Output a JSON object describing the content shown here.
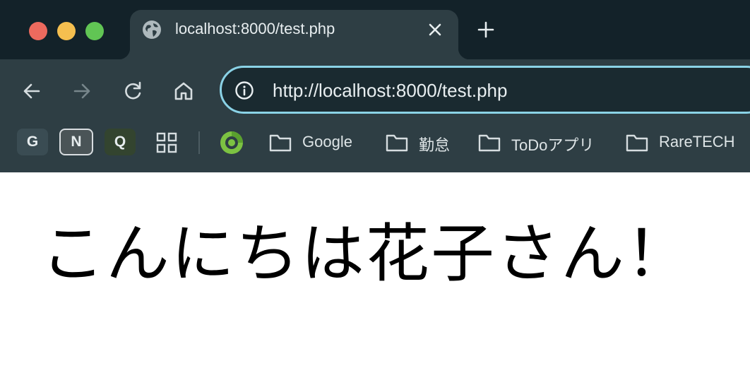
{
  "window": {
    "controls": [
      "close",
      "minimize",
      "maximize"
    ]
  },
  "tab": {
    "title": "localhost:8000/test.php",
    "favicon": "globe-icon"
  },
  "toolbar": {
    "icons": [
      "back-arrow-icon",
      "forward-arrow-icon",
      "reload-icon",
      "home-icon"
    ],
    "address": {
      "url": "http://localhost:8000/test.php",
      "site_info_icon": "info-icon",
      "focus_ring_color": "#8ad2e6"
    }
  },
  "bookmarks": {
    "badges": [
      "G",
      "N",
      "Q"
    ],
    "apps_icon": "apps-grid-icon",
    "extension_icon": "green-circle-logo-icon",
    "folders": [
      {
        "label": "Google"
      },
      {
        "label": "勤怠"
      },
      {
        "label": "ToDoアプリ"
      },
      {
        "label": "RareTECH"
      }
    ]
  },
  "page": {
    "greeting": "こんにちは花子さん！"
  },
  "colors": {
    "tabstrip": "#132229",
    "toolbar": "#2e3e44",
    "page_background": "#ffffff"
  }
}
